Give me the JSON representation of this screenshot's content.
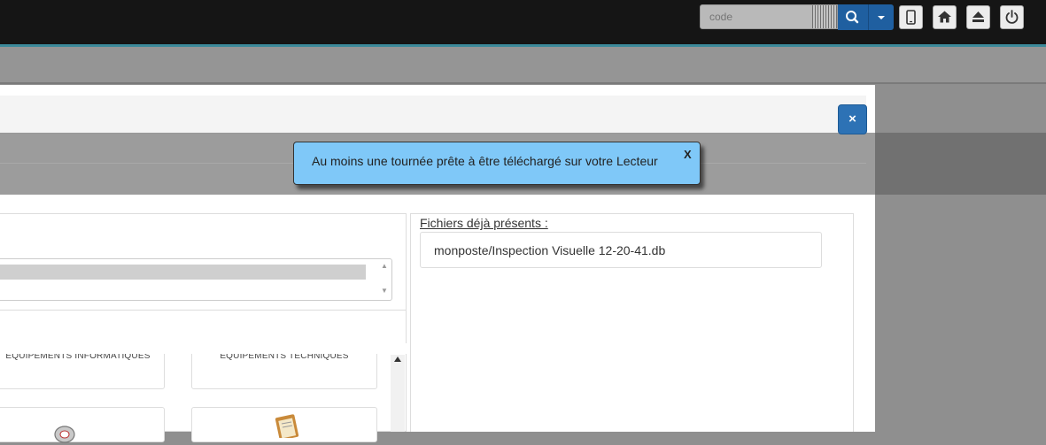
{
  "topbar": {
    "search": {
      "value": "",
      "placeholder": "code"
    },
    "icons": [
      "barcode-icon",
      "search-icon",
      "chevron-down-icon",
      "mobile-icon",
      "home-icon",
      "eject-icon",
      "power-icon"
    ]
  },
  "modal": {
    "close_label": "×",
    "toast": {
      "message": "Au moins une tournée prête à être téléchargé sur votre Lecteur",
      "close_label": "X"
    },
    "categories": [
      {
        "label": "EQUIPEMENTS INFORMATIQUES"
      },
      {
        "label": "EQUIPEMENTS TECHNIQUES"
      }
    ],
    "files": {
      "title": "Fichiers déjà présents :",
      "items": [
        "monposte/Inspection Visuelle 12-20-41.db"
      ]
    }
  },
  "colors": {
    "topbar": "#151515",
    "accent": "#1f5fa0",
    "toast": "#7fc8f8",
    "close_button": "#2d72b5"
  }
}
